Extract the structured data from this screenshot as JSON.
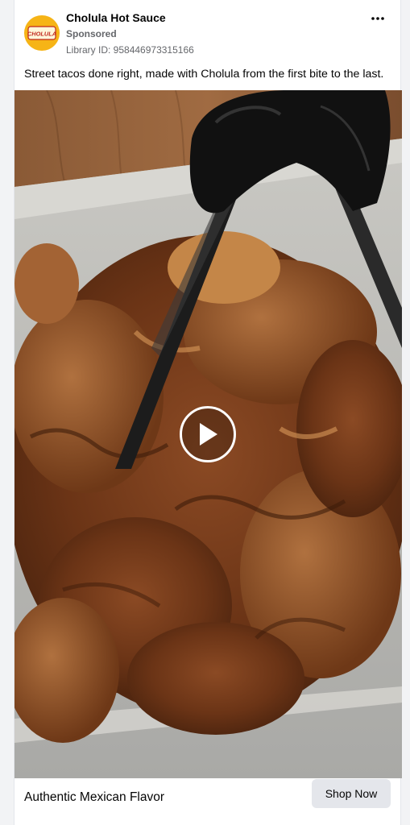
{
  "ad": {
    "page_name": "Cholula Hot Sauce",
    "sponsored_label": "Sponsored",
    "library_id": "Library ID: 958446973315166",
    "caption": "Street tacos done right, made with Cholula from the first bite to the last.",
    "avatar_text": "CHOLULA",
    "media_type": "video",
    "headline": "Authentic Mexican Flavor",
    "cta_label": "Shop Now"
  },
  "icons": {
    "more": "more-options-icon",
    "play": "play-icon"
  },
  "colors": {
    "avatar_bg": "#f6b416",
    "avatar_text": "#c0281e",
    "cta_bg": "#e4e6eb",
    "secondary_text": "#65676b"
  }
}
